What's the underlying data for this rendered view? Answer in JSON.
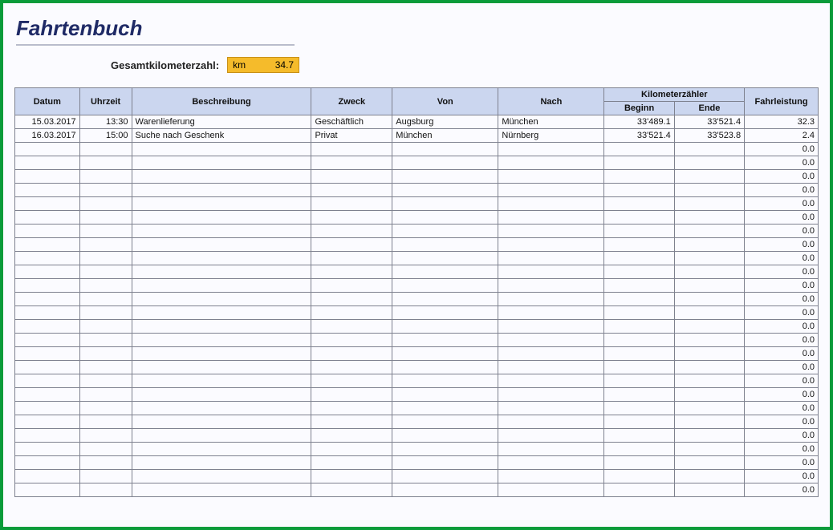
{
  "header": {
    "title": "Fahrtenbuch",
    "total_label": "Gesamtkilometerzahl:",
    "total_unit": "km",
    "total_value": "34.7"
  },
  "table": {
    "headers": {
      "datum": "Datum",
      "uhrzeit": "Uhrzeit",
      "beschreibung": "Beschreibung",
      "zweck": "Zweck",
      "von": "Von",
      "nach": "Nach",
      "km_group": "Kilometerzähler",
      "beginn": "Beginn",
      "ende": "Ende",
      "fahrleistung": "Fahrleistung"
    },
    "rows": [
      {
        "datum": "15.03.2017",
        "uhrzeit": "13:30",
        "beschreibung": "Warenlieferung",
        "zweck": "Geschäftlich",
        "von": "Augsburg",
        "nach": "München",
        "beginn": "33'489.1",
        "ende": "33'521.4",
        "fahrleistung": "32.3"
      },
      {
        "datum": "16.03.2017",
        "uhrzeit": "15:00",
        "beschreibung": "Suche nach Geschenk",
        "zweck": "Privat",
        "von": "München",
        "nach": "Nürnberg",
        "beginn": "33'521.4",
        "ende": "33'523.8",
        "fahrleistung": "2.4"
      },
      {
        "datum": "",
        "uhrzeit": "",
        "beschreibung": "",
        "zweck": "",
        "von": "",
        "nach": "",
        "beginn": "",
        "ende": "",
        "fahrleistung": "0.0"
      },
      {
        "datum": "",
        "uhrzeit": "",
        "beschreibung": "",
        "zweck": "",
        "von": "",
        "nach": "",
        "beginn": "",
        "ende": "",
        "fahrleistung": "0.0"
      },
      {
        "datum": "",
        "uhrzeit": "",
        "beschreibung": "",
        "zweck": "",
        "von": "",
        "nach": "",
        "beginn": "",
        "ende": "",
        "fahrleistung": "0.0"
      },
      {
        "datum": "",
        "uhrzeit": "",
        "beschreibung": "",
        "zweck": "",
        "von": "",
        "nach": "",
        "beginn": "",
        "ende": "",
        "fahrleistung": "0.0"
      },
      {
        "datum": "",
        "uhrzeit": "",
        "beschreibung": "",
        "zweck": "",
        "von": "",
        "nach": "",
        "beginn": "",
        "ende": "",
        "fahrleistung": "0.0"
      },
      {
        "datum": "",
        "uhrzeit": "",
        "beschreibung": "",
        "zweck": "",
        "von": "",
        "nach": "",
        "beginn": "",
        "ende": "",
        "fahrleistung": "0.0"
      },
      {
        "datum": "",
        "uhrzeit": "",
        "beschreibung": "",
        "zweck": "",
        "von": "",
        "nach": "",
        "beginn": "",
        "ende": "",
        "fahrleistung": "0.0"
      },
      {
        "datum": "",
        "uhrzeit": "",
        "beschreibung": "",
        "zweck": "",
        "von": "",
        "nach": "",
        "beginn": "",
        "ende": "",
        "fahrleistung": "0.0"
      },
      {
        "datum": "",
        "uhrzeit": "",
        "beschreibung": "",
        "zweck": "",
        "von": "",
        "nach": "",
        "beginn": "",
        "ende": "",
        "fahrleistung": "0.0"
      },
      {
        "datum": "",
        "uhrzeit": "",
        "beschreibung": "",
        "zweck": "",
        "von": "",
        "nach": "",
        "beginn": "",
        "ende": "",
        "fahrleistung": "0.0"
      },
      {
        "datum": "",
        "uhrzeit": "",
        "beschreibung": "",
        "zweck": "",
        "von": "",
        "nach": "",
        "beginn": "",
        "ende": "",
        "fahrleistung": "0.0"
      },
      {
        "datum": "",
        "uhrzeit": "",
        "beschreibung": "",
        "zweck": "",
        "von": "",
        "nach": "",
        "beginn": "",
        "ende": "",
        "fahrleistung": "0.0"
      },
      {
        "datum": "",
        "uhrzeit": "",
        "beschreibung": "",
        "zweck": "",
        "von": "",
        "nach": "",
        "beginn": "",
        "ende": "",
        "fahrleistung": "0.0"
      },
      {
        "datum": "",
        "uhrzeit": "",
        "beschreibung": "",
        "zweck": "",
        "von": "",
        "nach": "",
        "beginn": "",
        "ende": "",
        "fahrleistung": "0.0"
      },
      {
        "datum": "",
        "uhrzeit": "",
        "beschreibung": "",
        "zweck": "",
        "von": "",
        "nach": "",
        "beginn": "",
        "ende": "",
        "fahrleistung": "0.0"
      },
      {
        "datum": "",
        "uhrzeit": "",
        "beschreibung": "",
        "zweck": "",
        "von": "",
        "nach": "",
        "beginn": "",
        "ende": "",
        "fahrleistung": "0.0"
      },
      {
        "datum": "",
        "uhrzeit": "",
        "beschreibung": "",
        "zweck": "",
        "von": "",
        "nach": "",
        "beginn": "",
        "ende": "",
        "fahrleistung": "0.0"
      },
      {
        "datum": "",
        "uhrzeit": "",
        "beschreibung": "",
        "zweck": "",
        "von": "",
        "nach": "",
        "beginn": "",
        "ende": "",
        "fahrleistung": "0.0"
      },
      {
        "datum": "",
        "uhrzeit": "",
        "beschreibung": "",
        "zweck": "",
        "von": "",
        "nach": "",
        "beginn": "",
        "ende": "",
        "fahrleistung": "0.0"
      },
      {
        "datum": "",
        "uhrzeit": "",
        "beschreibung": "",
        "zweck": "",
        "von": "",
        "nach": "",
        "beginn": "",
        "ende": "",
        "fahrleistung": "0.0"
      },
      {
        "datum": "",
        "uhrzeit": "",
        "beschreibung": "",
        "zweck": "",
        "von": "",
        "nach": "",
        "beginn": "",
        "ende": "",
        "fahrleistung": "0.0"
      },
      {
        "datum": "",
        "uhrzeit": "",
        "beschreibung": "",
        "zweck": "",
        "von": "",
        "nach": "",
        "beginn": "",
        "ende": "",
        "fahrleistung": "0.0"
      },
      {
        "datum": "",
        "uhrzeit": "",
        "beschreibung": "",
        "zweck": "",
        "von": "",
        "nach": "",
        "beginn": "",
        "ende": "",
        "fahrleistung": "0.0"
      },
      {
        "datum": "",
        "uhrzeit": "",
        "beschreibung": "",
        "zweck": "",
        "von": "",
        "nach": "",
        "beginn": "",
        "ende": "",
        "fahrleistung": "0.0"
      },
      {
        "datum": "",
        "uhrzeit": "",
        "beschreibung": "",
        "zweck": "",
        "von": "",
        "nach": "",
        "beginn": "",
        "ende": "",
        "fahrleistung": "0.0"
      },
      {
        "datum": "",
        "uhrzeit": "",
        "beschreibung": "",
        "zweck": "",
        "von": "",
        "nach": "",
        "beginn": "",
        "ende": "",
        "fahrleistung": "0.0"
      }
    ]
  }
}
